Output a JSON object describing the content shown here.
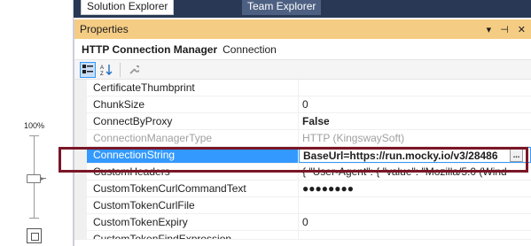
{
  "zoom": {
    "label": "100%"
  },
  "tabs": [
    {
      "label": "Solution Explorer",
      "active": true
    },
    {
      "label": "Team Explorer",
      "active": false
    }
  ],
  "properties": {
    "title": "Properties",
    "title_icons": [
      "pin-dropdown-icon",
      "pin-icon",
      "close-icon"
    ],
    "object_name": "HTTP Connection Manager",
    "object_type": "Connection",
    "toolbar": [
      "categorized-icon",
      "alphabetical-icon",
      "property-pages-icon"
    ],
    "rows": [
      {
        "name": "CertificateThumbprint",
        "value": ""
      },
      {
        "name": "ChunkSize",
        "value": "0"
      },
      {
        "name": "ConnectByProxy",
        "value": "False"
      },
      {
        "name": "ConnectionManagerType",
        "value": "HTTP (KingswaySoft)"
      },
      {
        "name": "ConnectionString",
        "value": "BaseUrl=https://run.mocky.io/v3/28486"
      },
      {
        "name": "CustomHeaders",
        "value": "{  \"User-Agent\": {    \"value\": \"Mozilla/5.0 (Wind"
      },
      {
        "name": "CustomTokenCurlCommandText",
        "value": "●●●●●●●●"
      },
      {
        "name": "CustomTokenCurlFile",
        "value": ""
      },
      {
        "name": "CustomTokenExpiry",
        "value": "0"
      },
      {
        "name": "CustomTokenFindExpression",
        "value": ""
      }
    ],
    "ellipsis_label": "..."
  },
  "colors": {
    "title_bar": "#f5cc84",
    "tab_strip": "#293955",
    "selection": "#3399ff",
    "highlight_border": "#7a1626"
  }
}
